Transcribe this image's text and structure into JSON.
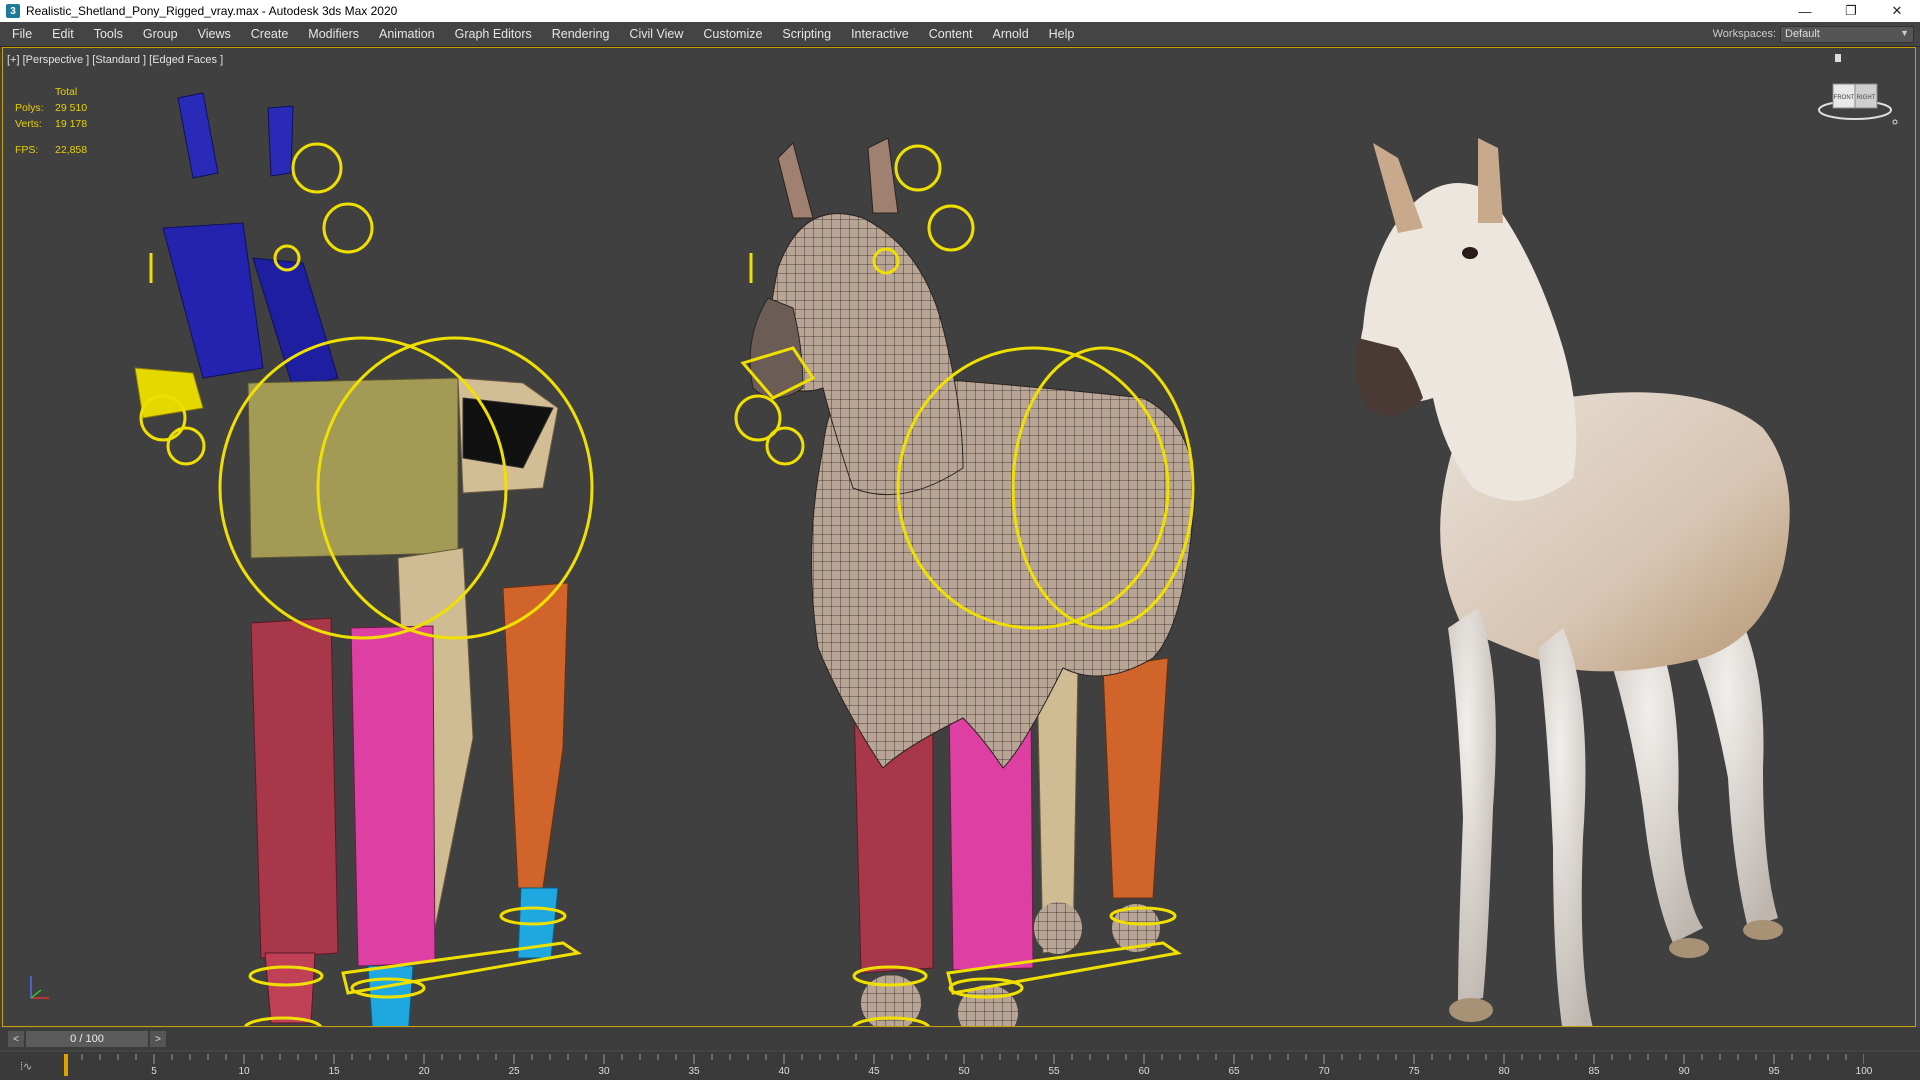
{
  "window": {
    "title": "Realistic_Shetland_Pony_Rigged_vray.max - Autodesk 3ds Max 2020",
    "controls": [
      "minimize-icon",
      "restore-icon",
      "close-icon"
    ],
    "min_glyph": "—",
    "restore_glyph": "❐",
    "close_glyph": "✕"
  },
  "menu": {
    "items": [
      "File",
      "Edit",
      "Tools",
      "Group",
      "Views",
      "Create",
      "Modifiers",
      "Animation",
      "Graph Editors",
      "Rendering",
      "Civil View",
      "Customize",
      "Scripting",
      "Interactive",
      "Content",
      "Arnold",
      "Help"
    ]
  },
  "workspaces": {
    "label": "Workspaces:",
    "value": "Default"
  },
  "viewport": {
    "label": "[+] [Perspective ] [Standard ] [Edged Faces ]",
    "stats": {
      "header": "Total",
      "polys_label": "Polys:",
      "polys": "29 510",
      "verts_label": "Verts:",
      "verts": "19 178",
      "fps_label": "FPS:",
      "fps": "22,858"
    },
    "viewcube": {
      "left": "FRONT",
      "right": "RIGHT"
    },
    "accent_color": "#f0e000",
    "border_color": "#c9a000"
  },
  "timeline": {
    "prev": "<",
    "frame": "0 / 100",
    "next": ">",
    "curve_icon": "curve-editor-icon",
    "curve_glyph": "⁞∿",
    "ticks": [
      "5",
      "10",
      "15",
      "20",
      "25",
      "30",
      "35",
      "40",
      "45",
      "50",
      "55",
      "60",
      "65",
      "70",
      "75",
      "80",
      "85",
      "90",
      "95",
      "100"
    ]
  }
}
